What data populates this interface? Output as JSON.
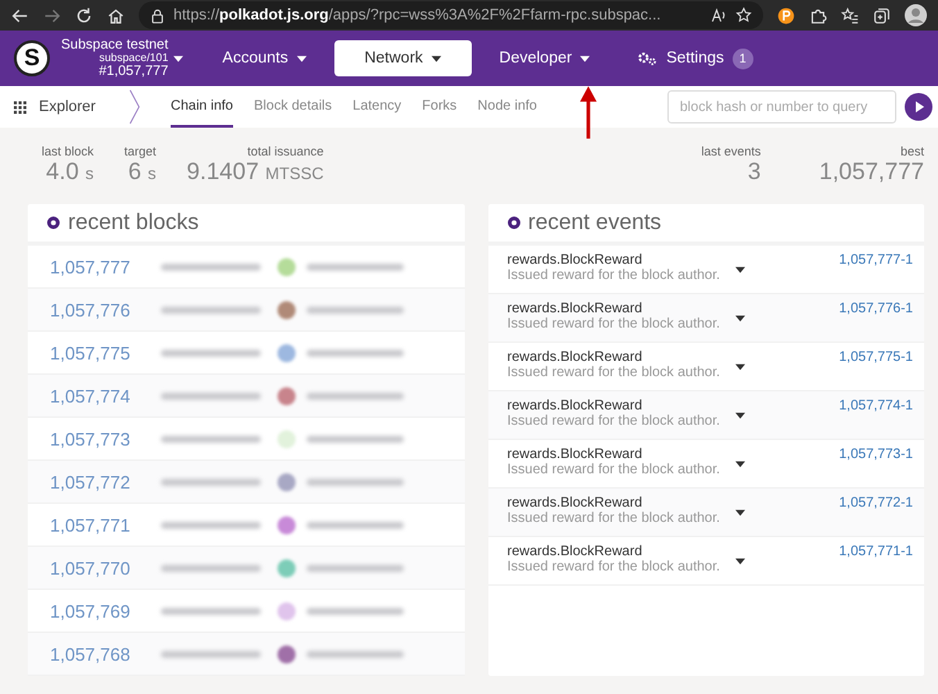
{
  "browser": {
    "url": "https://**polkadot.js.org**/apps/?rpc=wss%3A%2F%2Ffarm-rpc.subspac..."
  },
  "chain": {
    "logo_letter": "S",
    "name": "Subspace testnet",
    "spec": "subspace/101",
    "block": "#1,057,777"
  },
  "menu": [
    {
      "label": "Accounts",
      "kind": "dropdown",
      "selected": false
    },
    {
      "label": "Network",
      "kind": "dropdown",
      "selected": true
    },
    {
      "label": "Developer",
      "kind": "dropdown",
      "selected": false
    },
    {
      "label": "Settings",
      "kind": "settings",
      "selected": false,
      "badge": "1"
    }
  ],
  "subnav": {
    "section": "Explorer",
    "tabs": [
      {
        "label": "Chain info",
        "selected": true
      },
      {
        "label": "Block details",
        "selected": false
      },
      {
        "label": "Latency",
        "selected": false
      },
      {
        "label": "Forks",
        "selected": false
      },
      {
        "label": "Node info",
        "selected": false
      }
    ],
    "search": {
      "placeholder": "block hash or number to query"
    }
  },
  "stats_left": [
    {
      "label": "last block",
      "value": "4.0",
      "unit": "s"
    },
    {
      "label": "target",
      "value": "6",
      "unit": "s"
    },
    {
      "label": "total issuance",
      "value": "9.1407",
      "unit": "MTSSC"
    }
  ],
  "stats_right": [
    {
      "label": "last events",
      "value": "3"
    },
    {
      "label": "best",
      "value": "1,057,777"
    }
  ],
  "recent_blocks": {
    "title": "recent blocks",
    "rows": [
      {
        "number": "1,057,777",
        "color": "#b5dc9a"
      },
      {
        "number": "1,057,776",
        "color": "#b08a78"
      },
      {
        "number": "1,057,775",
        "color": "#9db8e0"
      },
      {
        "number": "1,057,774",
        "color": "#c8848c"
      },
      {
        "number": "1,057,773",
        "color": "#e2f2dc"
      },
      {
        "number": "1,057,772",
        "color": "#a8a8c4"
      },
      {
        "number": "1,057,771",
        "color": "#c88ad8"
      },
      {
        "number": "1,057,770",
        "color": "#7dcdb8"
      },
      {
        "number": "1,057,769",
        "color": "#e0c4ec"
      },
      {
        "number": "1,057,768",
        "color": "#a070a8"
      }
    ]
  },
  "recent_events": {
    "title": "recent events",
    "rows": [
      {
        "name": "rewards.BlockReward",
        "description": "Issued reward for the block author.",
        "ref": "1,057,777-1"
      },
      {
        "name": "rewards.BlockReward",
        "description": "Issued reward for the block author.",
        "ref": "1,057,776-1"
      },
      {
        "name": "rewards.BlockReward",
        "description": "Issued reward for the block author.",
        "ref": "1,057,775-1"
      },
      {
        "name": "rewards.BlockReward",
        "description": "Issued reward for the block author.",
        "ref": "1,057,774-1"
      },
      {
        "name": "rewards.BlockReward",
        "description": "Issued reward for the block author.",
        "ref": "1,057,773-1"
      },
      {
        "name": "rewards.BlockReward",
        "description": "Issued reward for the block author.",
        "ref": "1,057,772-1"
      },
      {
        "name": "rewards.BlockReward",
        "description": "Issued reward for the block author.",
        "ref": "1,057,771-1"
      }
    ]
  }
}
